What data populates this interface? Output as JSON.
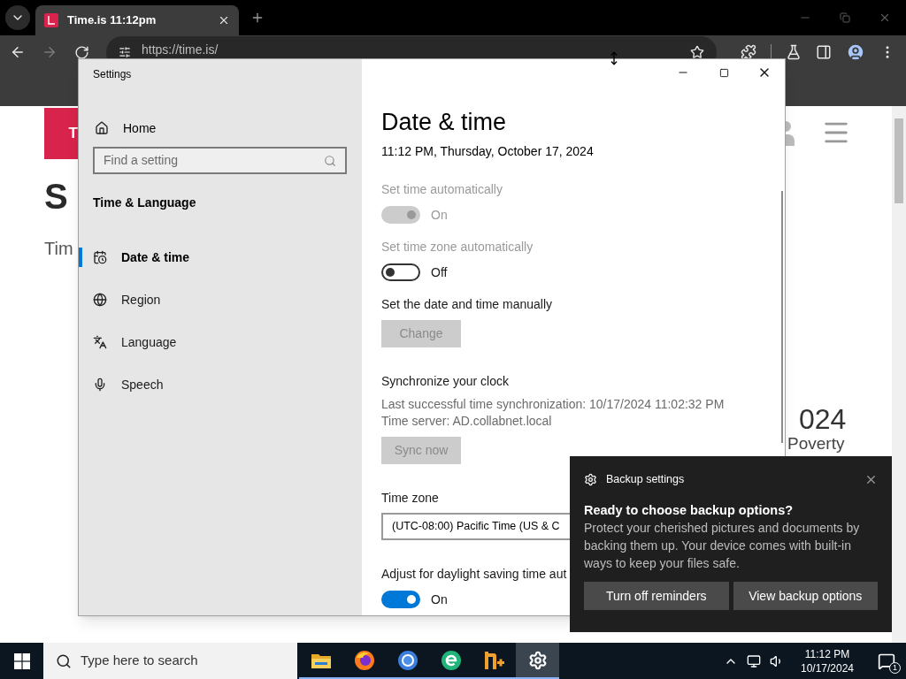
{
  "browser": {
    "tabs": [
      {
        "title": "Time.is 11:12pm",
        "selected": true
      }
    ],
    "address": "https://time.is/",
    "page": {
      "banner": "T",
      "heading": "S",
      "subheading": "Tim",
      "year": "024",
      "caption": "Poverty"
    }
  },
  "settings": {
    "title": "Settings",
    "home": "Home",
    "search": {
      "placeholder": "Find a setting"
    },
    "section": "Time & Language",
    "nav": [
      {
        "label": "Date & time",
        "selected": true
      },
      {
        "label": "Region",
        "selected": false
      },
      {
        "label": "Language",
        "selected": false
      },
      {
        "label": "Speech",
        "selected": false
      }
    ],
    "content": [
      {
        "kind": "title",
        "text": "Date & time"
      },
      {
        "kind": "text",
        "text": "11:12 PM, Thursday, October 17, 2024"
      },
      {
        "kind": "label",
        "text": "Set time automatically",
        "disabled": true
      },
      {
        "kind": "toggle",
        "text": "On",
        "on": true,
        "disabled": true
      },
      {
        "kind": "label",
        "text": "Set time zone automatically",
        "disabled": true
      },
      {
        "kind": "toggle",
        "text": "Off",
        "on": false,
        "disabled": false
      },
      {
        "kind": "label",
        "text": "Set the date and time manually",
        "disabled": false
      },
      {
        "kind": "button",
        "text": "Change",
        "disabled": true
      },
      {
        "kind": "heading",
        "text": "Synchronize your clock"
      },
      {
        "kind": "details",
        "lines": [
          "Last successful time synchronization: 10/17/2024 11:02:32 PM",
          "Time server: AD.collabnet.local"
        ]
      },
      {
        "kind": "button",
        "text": "Sync now",
        "disabled": true
      },
      {
        "kind": "heading",
        "text": "Time zone"
      },
      {
        "kind": "dropdown",
        "value": "(UTC-08:00) Pacific Time (US & C"
      },
      {
        "kind": "heading",
        "text": "Adjust for daylight saving time aut"
      },
      {
        "kind": "toggle",
        "text": "On",
        "on": true,
        "disabled": false
      }
    ]
  },
  "toast": {
    "app": "Backup settings",
    "title": "Ready to choose backup options?",
    "body": "Protect your cherished pictures and documents by backing them up. Your device comes with built-in ways to keep your files safe.",
    "buttons": [
      "Turn off reminders",
      "View backup options"
    ]
  },
  "taskbar": {
    "search": {
      "placeholder": "Type here to search"
    },
    "apps": [
      {
        "selected": false
      },
      {
        "selected": false
      },
      {
        "selected": false
      },
      {
        "selected": false
      },
      {
        "selected": false
      },
      {
        "selected": true
      }
    ],
    "time": "11:12 PM",
    "date": "10/17/2024",
    "notifications": "1"
  }
}
